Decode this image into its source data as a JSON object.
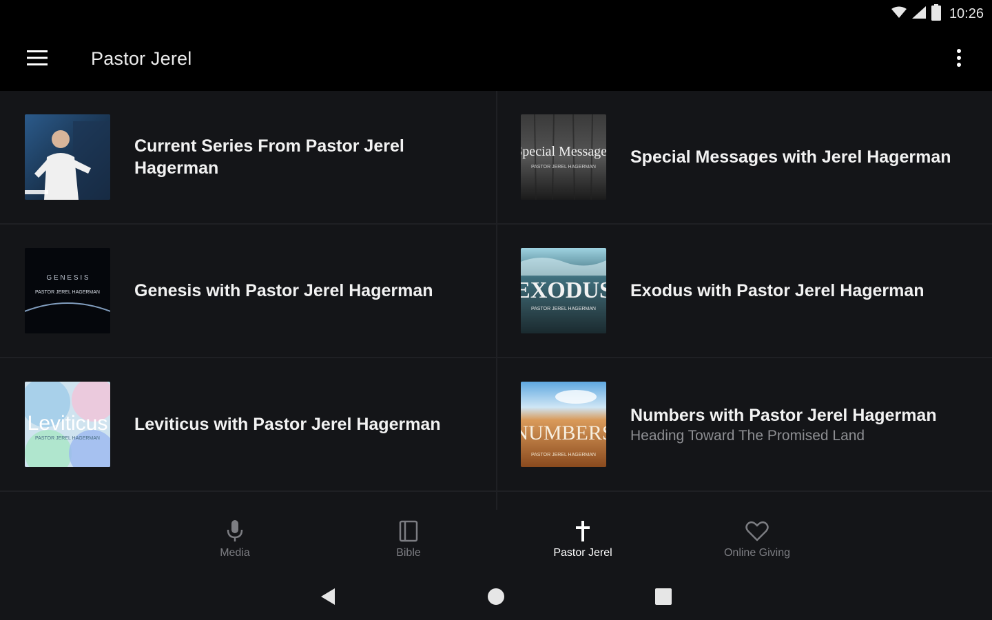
{
  "status_bar": {
    "time": "10:26",
    "icons": [
      "wifi-icon",
      "signal-icon",
      "battery-icon"
    ]
  },
  "app_bar": {
    "title": "Pastor Jerel",
    "menu_icon": "hamburger-menu-icon",
    "overflow_icon": "more-vert-icon"
  },
  "series": [
    {
      "title": "Current Series From Pastor Jerel Hagerman",
      "subtitle": ""
    },
    {
      "title": "Special Messages with Jerel Hagerman",
      "subtitle": "",
      "art_text": "Special Messages",
      "art_sub": "PASTOR JEREL HAGERMAN"
    },
    {
      "title": "Genesis with Pastor Jerel Hagerman",
      "subtitle": "",
      "art_text": "G E N E S I S",
      "art_sub": "PASTOR JEREL HAGERMAN"
    },
    {
      "title": "Exodus with Pastor Jerel Hagerman",
      "subtitle": "",
      "art_text": "EXODUS",
      "art_sub": "PASTOR JEREL HAGERMAN"
    },
    {
      "title": "Leviticus with Pastor Jerel Hagerman",
      "subtitle": "",
      "art_text": "Leviticus",
      "art_sub": "PASTOR JEREL HAGERMAN"
    },
    {
      "title": "Numbers with Pastor Jerel Hagerman",
      "subtitle": "Heading Toward The Promised Land",
      "art_text": "NUMBERS",
      "art_sub": "PASTOR JEREL HAGERMAN"
    }
  ],
  "bottom_nav": [
    {
      "label": "Media",
      "icon": "microphone-icon",
      "active": false
    },
    {
      "label": "Bible",
      "icon": "book-icon",
      "active": false
    },
    {
      "label": "Pastor Jerel",
      "icon": "cross-icon",
      "active": true
    },
    {
      "label": "Online Giving",
      "icon": "heart-icon",
      "active": false
    }
  ],
  "system_nav": [
    "back-icon",
    "home-icon",
    "recents-icon"
  ],
  "colors": {
    "background": "#141518",
    "bar": "#000000",
    "active": "#ffffff",
    "inactive": "#7c7d82"
  }
}
